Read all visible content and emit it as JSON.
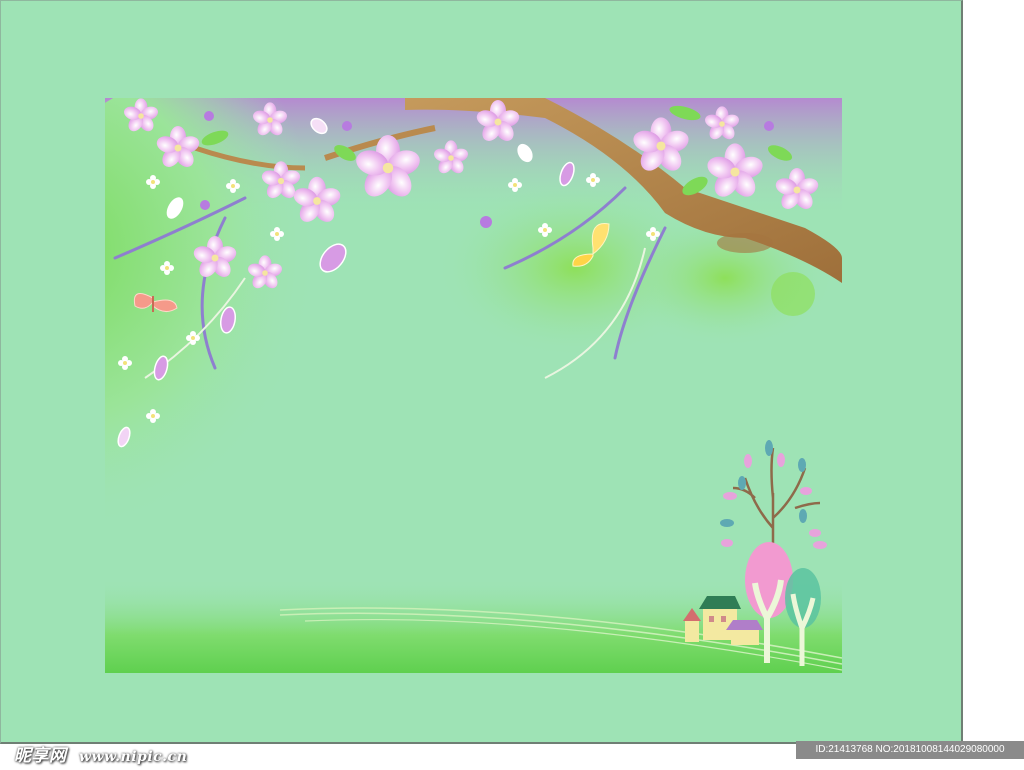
{
  "watermark": {
    "brand": "昵享网",
    "url": "www.nipic.cn",
    "image_id": "ID:21413768 NO:20181008144029080000"
  },
  "colors": {
    "outer_background": "#9ee3b5",
    "border": "#6f7f74",
    "blossom_pink": "#e6a8ec",
    "branch_brown": "#b98a4e",
    "grass_green": "#6fd86a"
  },
  "illustration": {
    "icons": [
      "cherry-blossom-icon",
      "butterfly-icon",
      "tree-icon",
      "house-icon",
      "petal-icon"
    ]
  }
}
